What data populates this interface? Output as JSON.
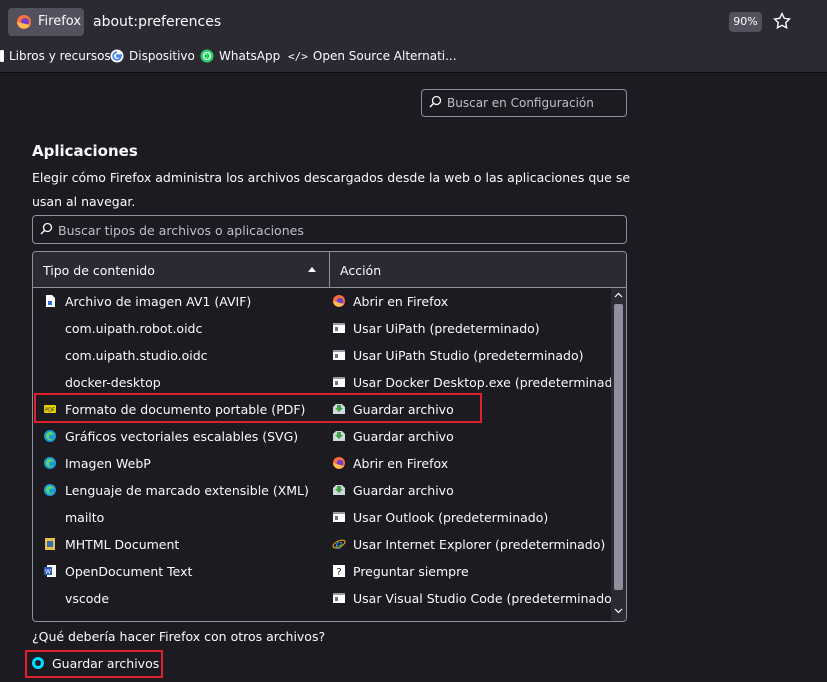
{
  "browser": {
    "identity_label": "Firefox",
    "url": "about:preferences",
    "zoom": "90%"
  },
  "bookmarks": [
    {
      "label": "Libros y recursos",
      "icon": "bookmark-folder-icon"
    },
    {
      "label": "Dispositivo",
      "icon": "google-icon"
    },
    {
      "label": "WhatsApp",
      "icon": "whatsapp-icon"
    },
    {
      "label": "Open Source Alternati...",
      "icon": "code-icon"
    }
  ],
  "search": {
    "placeholder": "Buscar en Configuración"
  },
  "applications": {
    "title": "Aplicaciones",
    "description": "Elegir cómo Firefox administra los archivos descargados desde la web o las aplicaciones que se usan al navegar.",
    "filter_placeholder": "Buscar tipos de archivos o aplicaciones",
    "columns": {
      "content_type": "Tipo de contenido",
      "action": "Acción"
    },
    "rows": [
      {
        "type": "Archivo de imagen AV1 (AVIF)",
        "type_icon": "file-icon",
        "action": "Abrir en Firefox",
        "action_icon": "firefox-icon"
      },
      {
        "type": "com.uipath.robot.oidc",
        "type_icon": "",
        "action": "Usar UiPath (predeterminado)",
        "action_icon": "app-icon"
      },
      {
        "type": "com.uipath.studio.oidc",
        "type_icon": "",
        "action": "Usar UiPath Studio (predeterminado)",
        "action_icon": "app-icon"
      },
      {
        "type": "docker-desktop",
        "type_icon": "",
        "action": "Usar Docker Desktop.exe (predeterminado)",
        "action_icon": "app-icon"
      },
      {
        "type": "Formato de documento portable (PDF)",
        "type_icon": "pdf-icon",
        "action": "Guardar archivo",
        "action_icon": "save-file-icon"
      },
      {
        "type": "Gráficos vectoriales escalables (SVG)",
        "type_icon": "edge-icon",
        "action": "Guardar archivo",
        "action_icon": "save-file-icon"
      },
      {
        "type": "Imagen WebP",
        "type_icon": "edge-icon",
        "action": "Abrir en Firefox",
        "action_icon": "firefox-icon"
      },
      {
        "type": "Lenguaje de marcado extensible (XML)",
        "type_icon": "edge-icon",
        "action": "Guardar archivo",
        "action_icon": "save-file-icon"
      },
      {
        "type": "mailto",
        "type_icon": "",
        "action": "Usar Outlook (predeterminado)",
        "action_icon": "app-icon"
      },
      {
        "type": "MHTML Document",
        "type_icon": "mhtml-icon",
        "action": "Usar Internet Explorer (predeterminado)",
        "action_icon": "internet-explorer-icon"
      },
      {
        "type": "OpenDocument Text",
        "type_icon": "word-icon",
        "action": "Preguntar siempre",
        "action_icon": "ask-icon"
      },
      {
        "type": "vscode",
        "type_icon": "",
        "action": "Usar Visual Studio Code (predeterminado)",
        "action_icon": "app-icon"
      }
    ],
    "other_files_question": "¿Qué debería hacer Firefox con otros archivos?",
    "other_files_option": "Guardar archivos"
  },
  "colors": {
    "highlight": "#e0202a",
    "accent": "#00ddff"
  }
}
